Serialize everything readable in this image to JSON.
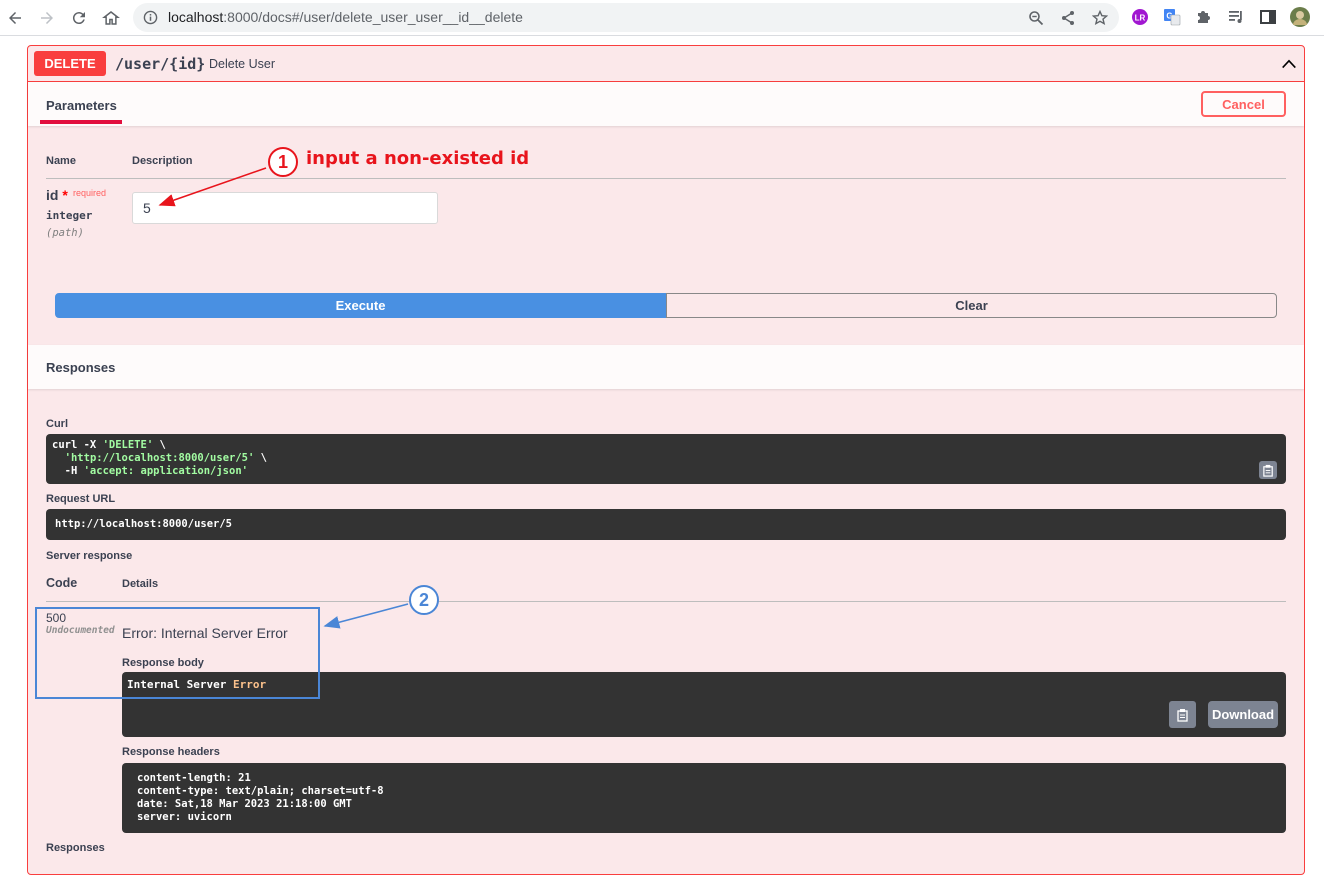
{
  "browser": {
    "url_host": "localhost",
    "url_rest": ":8000/docs#/user/delete_user_user__id__delete",
    "icons": [
      "back-arrow-icon",
      "forward-arrow-icon",
      "reload-icon",
      "home-icon",
      "info-icon",
      "zoom-icon",
      "share-icon",
      "star-icon",
      "lr-extension-icon",
      "translate-extension-icon",
      "puzzle-extension-icon",
      "media-control-icon",
      "side-panel-icon",
      "profile-avatar-icon"
    ]
  },
  "operation": {
    "method": "DELETE",
    "path": "/user/{id}",
    "summary": "Delete User",
    "colors": {
      "method_bg": "#f93e3e",
      "block_bg": "#fbe8ea",
      "execute": "#4990e2"
    }
  },
  "parameters": {
    "tab_label": "Parameters",
    "cancel_label": "Cancel",
    "col_name": "Name",
    "col_description": "Description",
    "param": {
      "name": "id",
      "star": "*",
      "required": "required",
      "type": "integer",
      "in": "(path)",
      "value": "5"
    },
    "execute_label": "Execute",
    "clear_label": "Clear"
  },
  "responses": {
    "heading": "Responses",
    "curl_label": "Curl",
    "curl_line1_a": "curl -X ",
    "curl_line1_b": "'DELETE'",
    "curl_line1_c": " \\",
    "curl_line2_a": "  ",
    "curl_line2_b": "'http://localhost:8000/user/5'",
    "curl_line2_c": " \\",
    "curl_line3_a": "  -H ",
    "curl_line3_b": "'accept: application/json'",
    "request_url_label": "Request URL",
    "request_url": "http://localhost:8000/user/5",
    "server_response_label": "Server response",
    "col_code": "Code",
    "col_details": "Details",
    "status_code": "500",
    "status_note": "Undocumented",
    "error_title": "Error: Internal Server Error",
    "response_body_label": "Response body",
    "body_a": "Internal Server ",
    "body_b": "Error",
    "download_label": "Download",
    "response_headers_label": "Response headers",
    "headers": [
      "content-length: 21",
      "content-type: text/plain; charset=utf-8",
      "date: Sat,18 Mar 2023 21:18:00 GMT",
      "server: uvicorn"
    ],
    "footer_heading": "Responses"
  },
  "annotations": {
    "one_number": "1",
    "one_text": "input a non-existed id",
    "one_color": "#e8141c",
    "two_number": "2",
    "two_color": "#4a86d6"
  }
}
